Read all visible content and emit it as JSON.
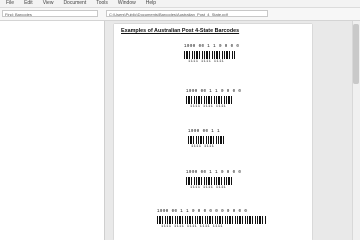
{
  "menu": [
    "File",
    "Edit",
    "View",
    "Document",
    "Tools",
    "Window",
    "Help"
  ],
  "toolbar": {
    "left_input": "Find: Barcodes",
    "path": "C:\\Users\\Public\\Documents\\Barcodes\\Australian_Post_4_State.pdf"
  },
  "document": {
    "title": "Examples of Australian Post 4-State Barcodes",
    "barcodes": [
      {
        "text": "1000 00 1 1 0 0 0 0",
        "sub": "1111 1111 1111"
      },
      {
        "text": "1000 00 1 1 0 0 0 0",
        "sub": "1111 1111 1111"
      },
      {
        "text": "1000 00 1 1",
        "sub": "1111 1111"
      },
      {
        "text": "1000 00 1 1 0 0 0 0",
        "sub": "1111 1111 1111"
      },
      {
        "text": "1000 00 1 1 0 0 0 0 0 0 0 0 0 0",
        "sub": "1111 1111 1111 1111 1111"
      }
    ]
  }
}
